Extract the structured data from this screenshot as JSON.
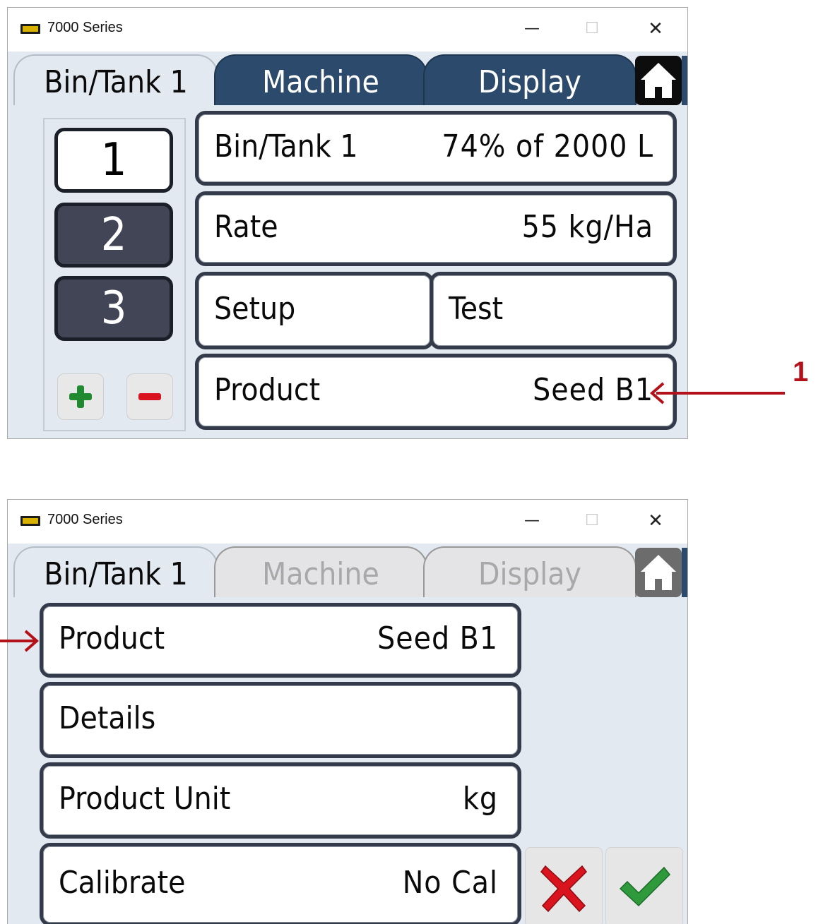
{
  "annotation": {
    "number": "1"
  },
  "screen1": {
    "window_title": "7000 Series",
    "window_controls": {
      "minimize": "—",
      "maximize": "☐",
      "close": "✕"
    },
    "tabs": [
      {
        "label": "Bin/Tank 1",
        "state": "active"
      },
      {
        "label": "Machine",
        "state": "inactive"
      },
      {
        "label": "Display",
        "state": "inactive"
      }
    ],
    "home_icon": "home-icon",
    "bins": [
      "1",
      "2",
      "3"
    ],
    "selected_bin": "1",
    "rows": {
      "bin_tank": {
        "label": "Bin/Tank 1",
        "value": "74% of 2000 L"
      },
      "rate": {
        "label": "Rate",
        "value": "55 kg/Ha"
      },
      "setup": {
        "label": "Setup"
      },
      "test": {
        "label": "Test"
      },
      "product": {
        "label": "Product",
        "value": "Seed B1"
      }
    },
    "add_icon": "plus-icon",
    "remove_icon": "minus-icon"
  },
  "screen2": {
    "window_title": "7000 Series",
    "window_controls": {
      "minimize": "—",
      "maximize": "☐",
      "close": "✕"
    },
    "tabs": [
      {
        "label": "Bin/Tank 1",
        "state": "active"
      },
      {
        "label": "Machine",
        "state": "disabled"
      },
      {
        "label": "Display",
        "state": "disabled"
      }
    ],
    "home_icon": "home-icon",
    "rows": {
      "product": {
        "label": "Product",
        "value": "Seed B1"
      },
      "details": {
        "label": "Details"
      },
      "product_unit": {
        "label": "Product Unit",
        "value": "kg"
      },
      "calibrate": {
        "label": "Calibrate",
        "value": "No Cal"
      }
    },
    "cancel_icon": "x-icon",
    "confirm_icon": "checkmark-icon"
  },
  "colors": {
    "tab_dark": "#2c4a6b",
    "panel_bg": "#e3e9f0",
    "row_border": "#333a49",
    "bin_inactive": "#414556",
    "annotation_red": "#b3121a",
    "confirm_green": "#2e9a3c",
    "cancel_red": "#d9141e"
  }
}
